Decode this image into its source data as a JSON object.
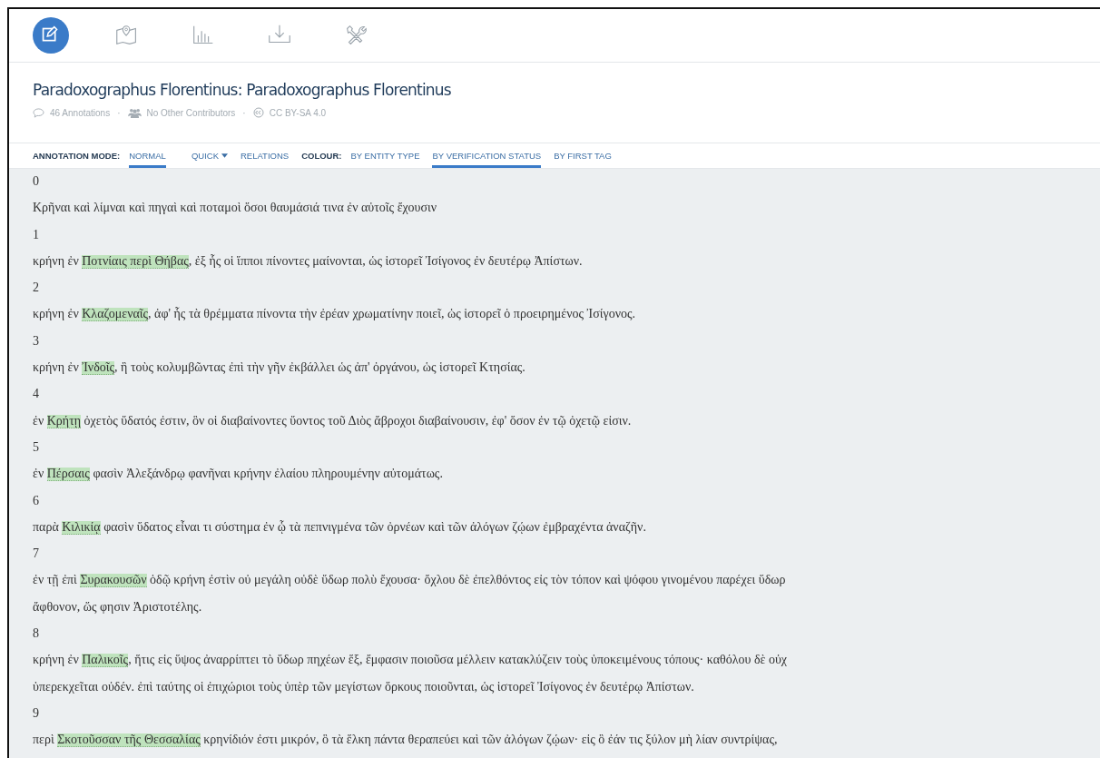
{
  "tools": [
    {
      "kind": "edit",
      "selected": true
    },
    {
      "kind": "map",
      "selected": false
    },
    {
      "kind": "chart",
      "selected": false
    },
    {
      "kind": "download",
      "selected": false
    },
    {
      "kind": "tools",
      "selected": false
    }
  ],
  "document": {
    "title": "Paradoxographus Florentinus: Paradoxographus Florentinus",
    "meta": [
      {
        "kind": "comments",
        "text": "46 Annotations"
      },
      {
        "kind": "separator",
        "text": "·"
      },
      {
        "kind": "users",
        "text": "No Other Contributors"
      },
      {
        "kind": "separator",
        "text": "·"
      },
      {
        "kind": "license",
        "text": "CC BY-SA 4.0"
      }
    ]
  },
  "mode_bar": [
    {
      "kind": "heading",
      "label": "ANNOTATION MODE:"
    },
    {
      "kind": "option",
      "label": "NORMAL",
      "selected": true
    },
    {
      "kind": "dropdown",
      "label": "QUICK",
      "selected": false
    },
    {
      "kind": "option",
      "label": "RELATIONS",
      "selected": false
    },
    {
      "kind": "heading",
      "label": "COLOUR:"
    },
    {
      "kind": "option",
      "label": "BY ENTITY TYPE",
      "selected": false
    },
    {
      "kind": "option",
      "label": "BY VERIFICATION STATUS",
      "selected": true
    },
    {
      "kind": "option",
      "label": "BY FIRST TAG",
      "selected": false
    }
  ],
  "sections": [
    {
      "number": "0",
      "lines": [
        [
          {
            "kind": "plain",
            "text": "Κρῆναι καὶ λίμναι καὶ πηγαὶ καὶ ποταμοὶ ὅσοι θαυμάσιά τινα ἐν αὐτοῖς ἔχουσιν"
          }
        ]
      ]
    },
    {
      "number": "1",
      "lines": [
        [
          {
            "kind": "plain",
            "text": "κρήνη ἐν "
          },
          {
            "kind": "entity",
            "text": "Ποτνίαις περὶ Θήβας"
          },
          {
            "kind": "plain",
            "text": ", ἐξ ἧς οἱ ἵπποι πίνοντες μαίνονται, ὡς ἱστορεῖ Ἰσίγονος ἐν δευτέρῳ Ἀπίστων."
          }
        ]
      ]
    },
    {
      "number": "2",
      "lines": [
        [
          {
            "kind": "plain",
            "text": "κρήνη ἐν "
          },
          {
            "kind": "entity",
            "text": "Κλαζομεναῖς"
          },
          {
            "kind": "plain",
            "text": ", ἀφ' ἧς τὰ θρέμματα πίνοντα τὴν ἐρέαν χρωματίνην ποιεῖ, ὡς ἱστορεῖ ὁ προειρημένος Ἰσίγονος."
          }
        ]
      ]
    },
    {
      "number": "3",
      "lines": [
        [
          {
            "kind": "plain",
            "text": "κρήνη ἐν "
          },
          {
            "kind": "entity",
            "text": "Ἰνδοῖς"
          },
          {
            "kind": "plain",
            "text": ", ἣ τοὺς κολυμβῶντας ἐπὶ τὴν γῆν ἐκβάλλει ὡς ἀπ' ὀργάνου, ὡς ἱστορεῖ Κτησίας."
          }
        ]
      ]
    },
    {
      "number": "4",
      "lines": [
        [
          {
            "kind": "plain",
            "text": "ἐν "
          },
          {
            "kind": "entity",
            "text": "Κρήτῃ"
          },
          {
            "kind": "plain",
            "text": " ὀχετὸς ὕδατός ἐστιν, ὃν οἱ διαβαίνοντες ὕοντος τοῦ Διὸς ἄβροχοι διαβαίνουσιν, ἐφ' ὅσον ἐν τῷ ὀχετῷ εἰσιν."
          }
        ]
      ]
    },
    {
      "number": "5",
      "lines": [
        [
          {
            "kind": "plain",
            "text": "ἐν "
          },
          {
            "kind": "entity",
            "text": "Πέρσαις"
          },
          {
            "kind": "plain",
            "text": " φασὶν Ἀλεξάνδρῳ φανῆναι κρήνην ἐλαίου πληρουμένην αὐτομάτως."
          }
        ]
      ]
    },
    {
      "number": "6",
      "lines": [
        [
          {
            "kind": "plain",
            "text": "παρὰ "
          },
          {
            "kind": "entity",
            "text": "Κιλικίᾳ"
          },
          {
            "kind": "plain",
            "text": " φασὶν ὕδατος εἶναι τι σύστημα ἐν ᾧ τὰ πεπνιγμένα τῶν ὀρνέων καὶ τῶν ἀλόγων ζῴων ἐμβραχέντα ἀναζῆν."
          }
        ]
      ]
    },
    {
      "number": "7",
      "lines": [
        [
          {
            "kind": "plain",
            "text": "ἐν τῇ ἐπὶ "
          },
          {
            "kind": "entity",
            "text": "Συρακουσῶν"
          },
          {
            "kind": "plain",
            "text": " ὁδῷ κρήνη ἐστὶν οὐ μεγάλη οὐδὲ ὕδωρ πολὺ ἔχουσα· ὄχλου δὲ ἐπελθόντος εἰς τὸν τόπον καὶ ψόφου γινομένου παρέχει ὕδωρ"
          }
        ],
        [
          {
            "kind": "plain",
            "text": "ἄφθονον, ὥς φησιν Ἀριστοτέλης."
          }
        ]
      ]
    },
    {
      "number": "8",
      "lines": [
        [
          {
            "kind": "plain",
            "text": "κρήνη ἐν "
          },
          {
            "kind": "entity",
            "text": "Παλικοῖς"
          },
          {
            "kind": "plain",
            "text": ", ἥτις εἰς ὕψος ἀναρρίπτει τὸ ὕδωρ πηχέων ἕξ, ἔμφασιν ποιοῦσα μέλλειν κατακλύζειν τοὺς ὑποκειμένους τόπους· καθόλου δὲ οὐχ"
          }
        ],
        [
          {
            "kind": "plain",
            "text": "ὑπερεκχεῖται οὐδέν. ἐπὶ ταύτης οἱ ἐπιχώριοι τοὺς ὑπὲρ τῶν μεγίστων ὅρκους ποιοῦνται, ὡς ἱστορεῖ Ἰσίγονος ἐν δευτέρῳ Ἀπίστων."
          }
        ]
      ]
    },
    {
      "number": "9",
      "lines": [
        [
          {
            "kind": "plain",
            "text": "περὶ "
          },
          {
            "kind": "entity",
            "text": "Σκοτοῦσσαν τῆς Θεσσαλίας"
          },
          {
            "kind": "plain",
            "text": " κρηνίδιόν ἐστι μικρόν, ὃ τὰ ἕλκη πάντα θεραπεύει καὶ τῶν ἀλόγων ζῴων· εἰς ὃ ἐάν τις ξύλον μὴ λίαν συντρίψας,"
          }
        ]
      ]
    }
  ]
}
